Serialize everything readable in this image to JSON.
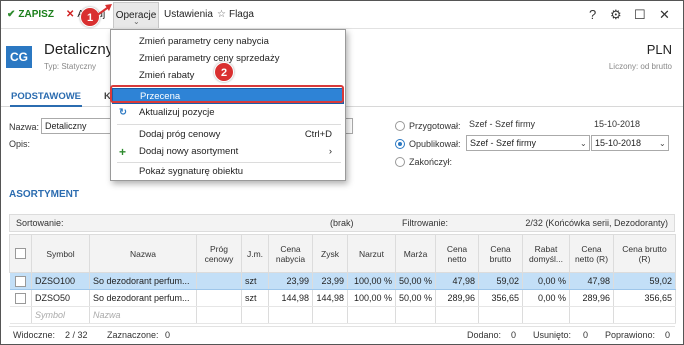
{
  "toolbar": {
    "save": "ZAPISZ",
    "cancel": "Anuluj",
    "operations": "Operacje",
    "settings": "Ustawienia",
    "flag": "Flaga",
    "help": "?",
    "gear": "⚙",
    "maximize": "☐",
    "close": "✕"
  },
  "header": {
    "logo": "CG",
    "title": "Detaliczny",
    "subtitle": "Typ: Statyczny",
    "currency": "PLN",
    "note": "Liczony: od brutto"
  },
  "tabs": [
    "PODSTAWOWE",
    "K"
  ],
  "form": {
    "name_label": "Nazwa:",
    "name_value": "Detaliczny",
    "desc_label": "Opis:"
  },
  "status": [
    {
      "label": "Przygotował:",
      "user": "Szef - Szef firmy",
      "date": "15-10-2018",
      "selected": false
    },
    {
      "label": "Opublikował:",
      "user": "Szef - Szef firmy",
      "date": "15-10-2018",
      "selected": true
    },
    {
      "label": "Zakończył:",
      "user": "",
      "date": "",
      "selected": false
    }
  ],
  "section": {
    "title": "ASORTYMENT",
    "sort_label": "Sortowanie:",
    "sort_value": "(brak)",
    "filter_label": "Filtrowanie:",
    "filter_value": "2/32 (Końcówka serii, Dezodoranty)"
  },
  "grid": {
    "columns": [
      "",
      "Symbol",
      "Nazwa",
      "Próg cenowy",
      "J.m.",
      "Cena nabycia",
      "Zysk",
      "Narzut",
      "Marża",
      "Cena netto",
      "Cena brutto",
      "Rabat domyśl...",
      "Cena netto (R)",
      "Cena brutto (R)"
    ],
    "rows": [
      [
        "DZSO100",
        "So dezodorant perfum...",
        "",
        "szt",
        "23,99",
        "23,99",
        "100,00 %",
        "50,00 %",
        "47,98",
        "59,02",
        "0,00 %",
        "47,98",
        "59,02"
      ],
      [
        "DZSO50",
        "So dezodorant perfum...",
        "",
        "szt",
        "144,98",
        "144,98",
        "100,00 %",
        "50,00 %",
        "289,96",
        "356,65",
        "0,00 %",
        "289,96",
        "356,65"
      ]
    ],
    "new_symbol": "Symbol",
    "new_name": "Nazwa"
  },
  "footer": {
    "visible_label": "Widoczne:",
    "visible_value": "2 / 32",
    "selected_label": "Zaznaczone:",
    "selected_value": "0",
    "added_label": "Dodano:",
    "added_value": "0",
    "removed_label": "Usunięto:",
    "removed_value": "0",
    "fixed_label": "Poprawiono:",
    "fixed_value": "0"
  },
  "menu": {
    "items": [
      "Zmień parametry ceny nabycia",
      "Zmień parametry ceny sprzedaży",
      "Zmień rabaty",
      "Przecena",
      "Aktualizuj pozycje",
      "Dodaj próg cenowy",
      "Dodaj nowy asortyment",
      "Pokaż sygnaturę obiektu"
    ],
    "shortcut": "Ctrl+D",
    "submenu_arrow": "›"
  },
  "callouts": [
    "1",
    "2"
  ],
  "colors": {
    "accent": "#2b6cb0",
    "highlight": "#2e83d6",
    "selected_row": "#c3dff7",
    "callout": "#d93030"
  }
}
